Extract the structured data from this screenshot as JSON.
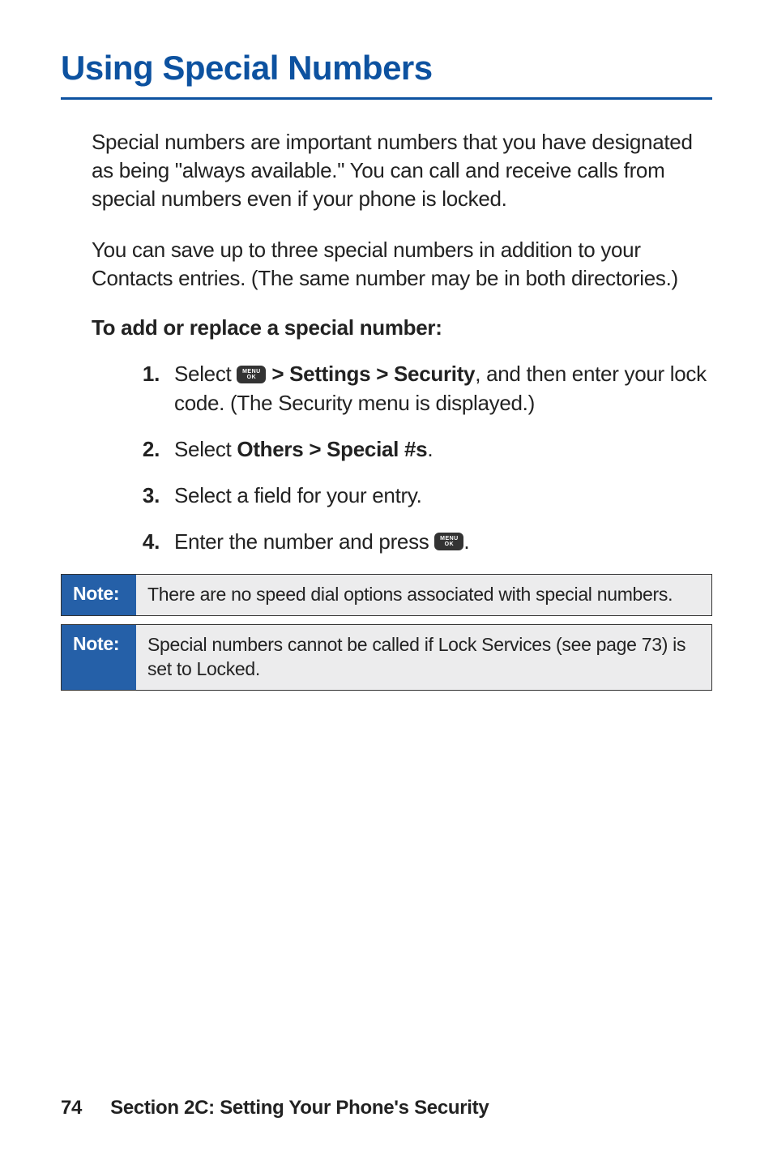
{
  "heading": "Using Special Numbers",
  "para1": "Special numbers are important numbers that you have designated as being \"always available.\" You can call and receive calls from special numbers even if your phone is locked.",
  "para2": "You can save up to three special numbers in addition to your Contacts entries. (The same number may be in both directories.)",
  "subheading": "To add or replace a special number:",
  "steps": [
    {
      "num": "1.",
      "pre": "Select ",
      "bold": " > Settings > Security",
      "post": ", and then enter your lock code. (The Security menu is displayed.)"
    },
    {
      "num": "2.",
      "pre": "Select ",
      "bold": "Others > Special #s",
      "post": "."
    },
    {
      "num": "3.",
      "pre": "Select a field for your entry.",
      "bold": "",
      "post": ""
    },
    {
      "num": "4.",
      "pre": "Enter the number and press ",
      "bold": "",
      "post": "."
    }
  ],
  "note1_label": "Note:",
  "note1_text": "There are no speed dial options associated with special numbers.",
  "note2_label": "Note:",
  "note2_text": "Special numbers cannot be called if Lock Services (see page 73) is set to Locked.",
  "footer_page": "74",
  "footer_section": "Section 2C: Setting Your Phone's Security",
  "menu_icon_top": "MENU",
  "menu_icon_bottom": "OK"
}
